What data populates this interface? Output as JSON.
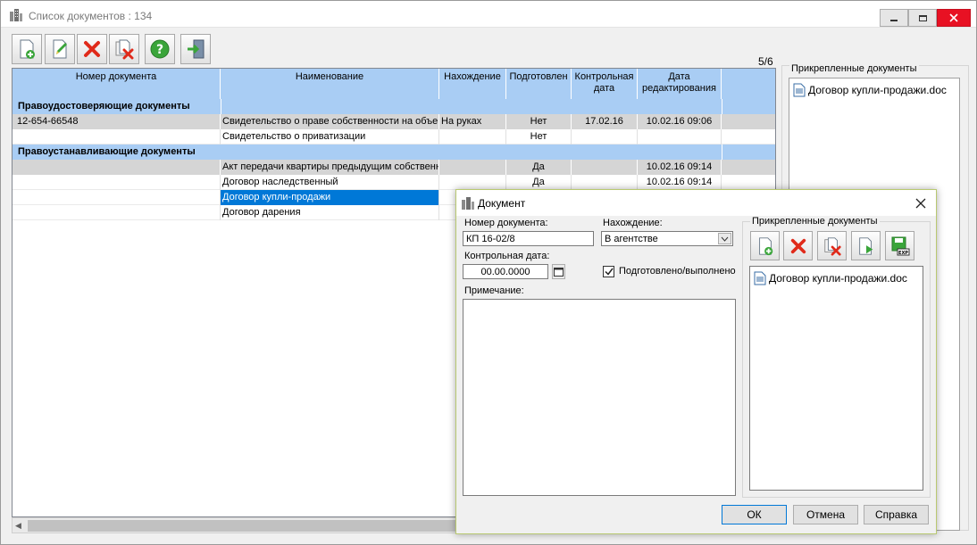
{
  "window": {
    "title": "Список документов : 134"
  },
  "toolbar": {
    "buttons": [
      {
        "name": "add-document-button",
        "icon": "add-document-icon"
      },
      {
        "name": "edit-document-button",
        "icon": "edit-icon"
      },
      {
        "name": "delete-button",
        "icon": "delete-x-icon"
      },
      {
        "name": "delete-document-button",
        "icon": "delete-document-icon"
      },
      {
        "name": "help-button",
        "icon": "help-icon"
      },
      {
        "name": "exit-button",
        "icon": "exit-door-icon"
      }
    ]
  },
  "counter": "5/6",
  "grid": {
    "columns": [
      "Номер документа",
      "Наименование",
      "Нахождение",
      "Подготовлен",
      "Контрольная дата",
      "Дата редактирования"
    ],
    "groups": [
      {
        "title": "Правоудостоверяющие документы",
        "rows": [
          {
            "number": "12-654-66548",
            "name": "Свидетельство о праве собственности на объект",
            "location": "На руках",
            "prepared": "Нет",
            "control_date": "17.02.16",
            "edit_date": "10.02.16 09:06",
            "style": "gray"
          },
          {
            "number": "",
            "name": "Свидетельство о приватизации",
            "location": "",
            "prepared": "Нет",
            "control_date": "",
            "edit_date": "",
            "style": "white"
          }
        ]
      },
      {
        "title": "Правоустанавливающие документы",
        "rows": [
          {
            "number": "",
            "name": "Акт передачи квартиры предыдущим собственн",
            "location": "",
            "prepared": "Да",
            "control_date": "",
            "edit_date": "10.02.16 09:14",
            "style": "gray"
          },
          {
            "number": "",
            "name": "Договор наследственный",
            "location": "",
            "prepared": "Да",
            "control_date": "",
            "edit_date": "10.02.16 09:14",
            "style": "white"
          },
          {
            "number": "",
            "name": "Договор купли-продажи",
            "location": "",
            "prepared": "",
            "control_date": "",
            "edit_date": "",
            "style": "selected"
          },
          {
            "number": "",
            "name": "Договор дарения",
            "location": "",
            "prepared": "",
            "control_date": "",
            "edit_date": "",
            "style": "white"
          }
        ]
      }
    ]
  },
  "attached_panel": {
    "legend": "Прикрепленные документы",
    "files": [
      "Договор купли-продажи.doc"
    ]
  },
  "dialog": {
    "title": "Документ",
    "doc_number_label": "Номер документа:",
    "doc_number_value": "КП 16-02/8",
    "location_label": "Нахождение:",
    "location_value": "В агентстве",
    "control_date_label": "Контрольная дата:",
    "control_date_value": "00.00.0000",
    "prepared_label": "Подготовлено/выполнено",
    "prepared_checked": true,
    "note_label": "Примечание:",
    "note_value": "",
    "attached_legend": "Прикрепленные документы",
    "attached_files": [
      "Договор купли-продажи.doc"
    ],
    "buttons": {
      "ok": "ОК",
      "cancel": "Отмена",
      "help": "Справка"
    }
  },
  "colors": {
    "header_blue": "#a9cdf4",
    "selection": "#0078d7",
    "gray_row": "#d5d5d5"
  }
}
